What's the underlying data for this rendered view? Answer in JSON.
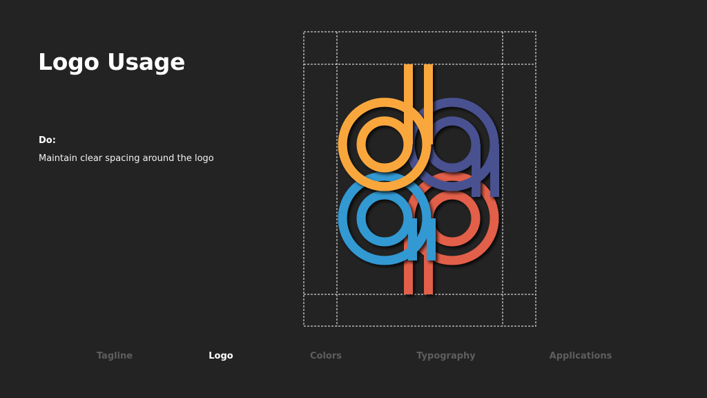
{
  "page": {
    "title": "Logo Usage",
    "do_heading": "Do:",
    "do_text": "Maintain clear spacing around the logo"
  },
  "logo": {
    "colors": {
      "orange": "#F9A73E",
      "indigo": "#4A5190",
      "blue": "#3399D2",
      "red": "#E25F48",
      "guide": "#FFFFFF",
      "background": "#232323"
    },
    "guide_style": "dashed"
  },
  "nav": {
    "items": [
      {
        "label": "Tagline",
        "active": false
      },
      {
        "label": "Logo",
        "active": true
      },
      {
        "label": "Colors",
        "active": false
      },
      {
        "label": "Typography",
        "active": false
      },
      {
        "label": "Applications",
        "active": false
      }
    ]
  }
}
